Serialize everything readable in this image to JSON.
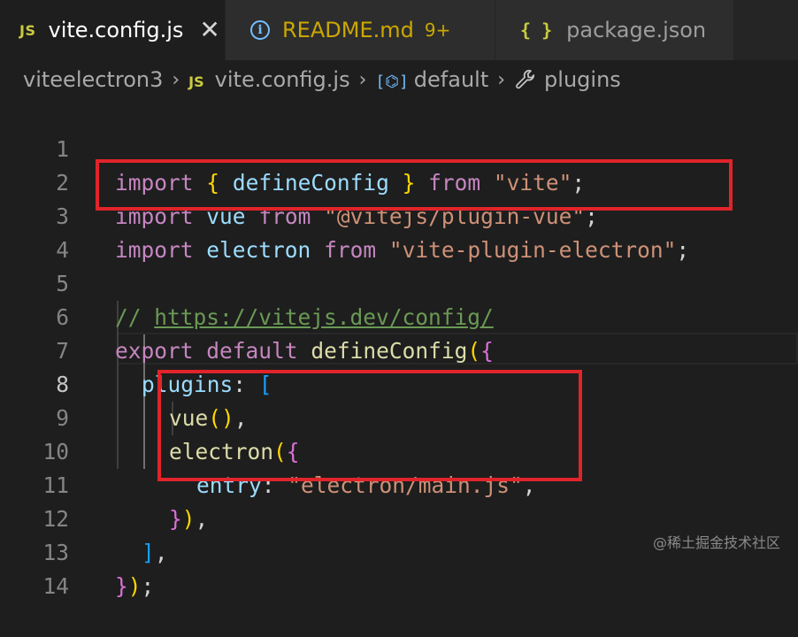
{
  "tabs": [
    {
      "icon": "JS",
      "label": "vite.config.js",
      "close": "✕"
    },
    {
      "icon": "i",
      "label": "README.md",
      "badge": "9+"
    },
    {
      "icon": "{ }",
      "label": "package.json"
    }
  ],
  "breadcrumb": {
    "project": "viteelectron3",
    "file_icon": "JS",
    "file": "vite.config.js",
    "symbol_icon": "[⌬]",
    "symbol": "default",
    "property": "plugins"
  },
  "editor": {
    "line_numbers": [
      "1",
      "2",
      "3",
      "4",
      "5",
      "6",
      "7",
      "8",
      "9",
      "10",
      "11",
      "12",
      "13",
      "14"
    ],
    "current_line": "8",
    "code": {
      "l1": {
        "k1": "import",
        "p1": " ",
        "b1": "{",
        "p2": " ",
        "v1": "defineConfig",
        "p3": " ",
        "b2": "}",
        "p4": " ",
        "k2": "from",
        "p5": " ",
        "s1": "\"vite\"",
        "p6": ";"
      },
      "l2": {
        "k1": "import",
        "p1": " ",
        "v1": "vue",
        "p2": " ",
        "k2": "from",
        "p3": " ",
        "s1": "\"@vitejs/plugin-vue\"",
        "p4": ";"
      },
      "l3": {
        "k1": "import",
        "p1": " ",
        "v1": "electron",
        "p2": " ",
        "k2": "from",
        "p3": " ",
        "s1": "\"vite-plugin-electron\"",
        "p4": ";"
      },
      "l5": {
        "c1": "// ",
        "u1": "https://vitejs.dev/config/"
      },
      "l6": {
        "k1": "export",
        "p1": " ",
        "k2": "default",
        "p2": " ",
        "f1": "defineConfig",
        "b1": "(",
        "b2": "{"
      },
      "l7": {
        "v1": "plugins",
        "p1": ": ",
        "b1": "["
      },
      "l8": {
        "f1": "vue",
        "b1": "()",
        "p1": ","
      },
      "l9": {
        "f1": "electron",
        "b1": "(",
        "b2": "{"
      },
      "l10": {
        "v1": "entry",
        "p1": ": ",
        "s1": "\"electron/main.js\"",
        "p2": ","
      },
      "l11": {
        "b1": "}",
        "b2": ")",
        "p1": ","
      },
      "l12": {
        "b1": "]",
        "p1": ","
      },
      "l13": {
        "b1": "}",
        "b2": ")",
        "p1": ";"
      }
    }
  },
  "watermark": "@稀土掘金技术社区",
  "colors": {
    "highlight_box": "#e0242a",
    "keyword": "#c586c0",
    "string": "#ce9178",
    "function": "#dcdcaa",
    "variable": "#9cdcfe",
    "comment": "#6a9955"
  }
}
